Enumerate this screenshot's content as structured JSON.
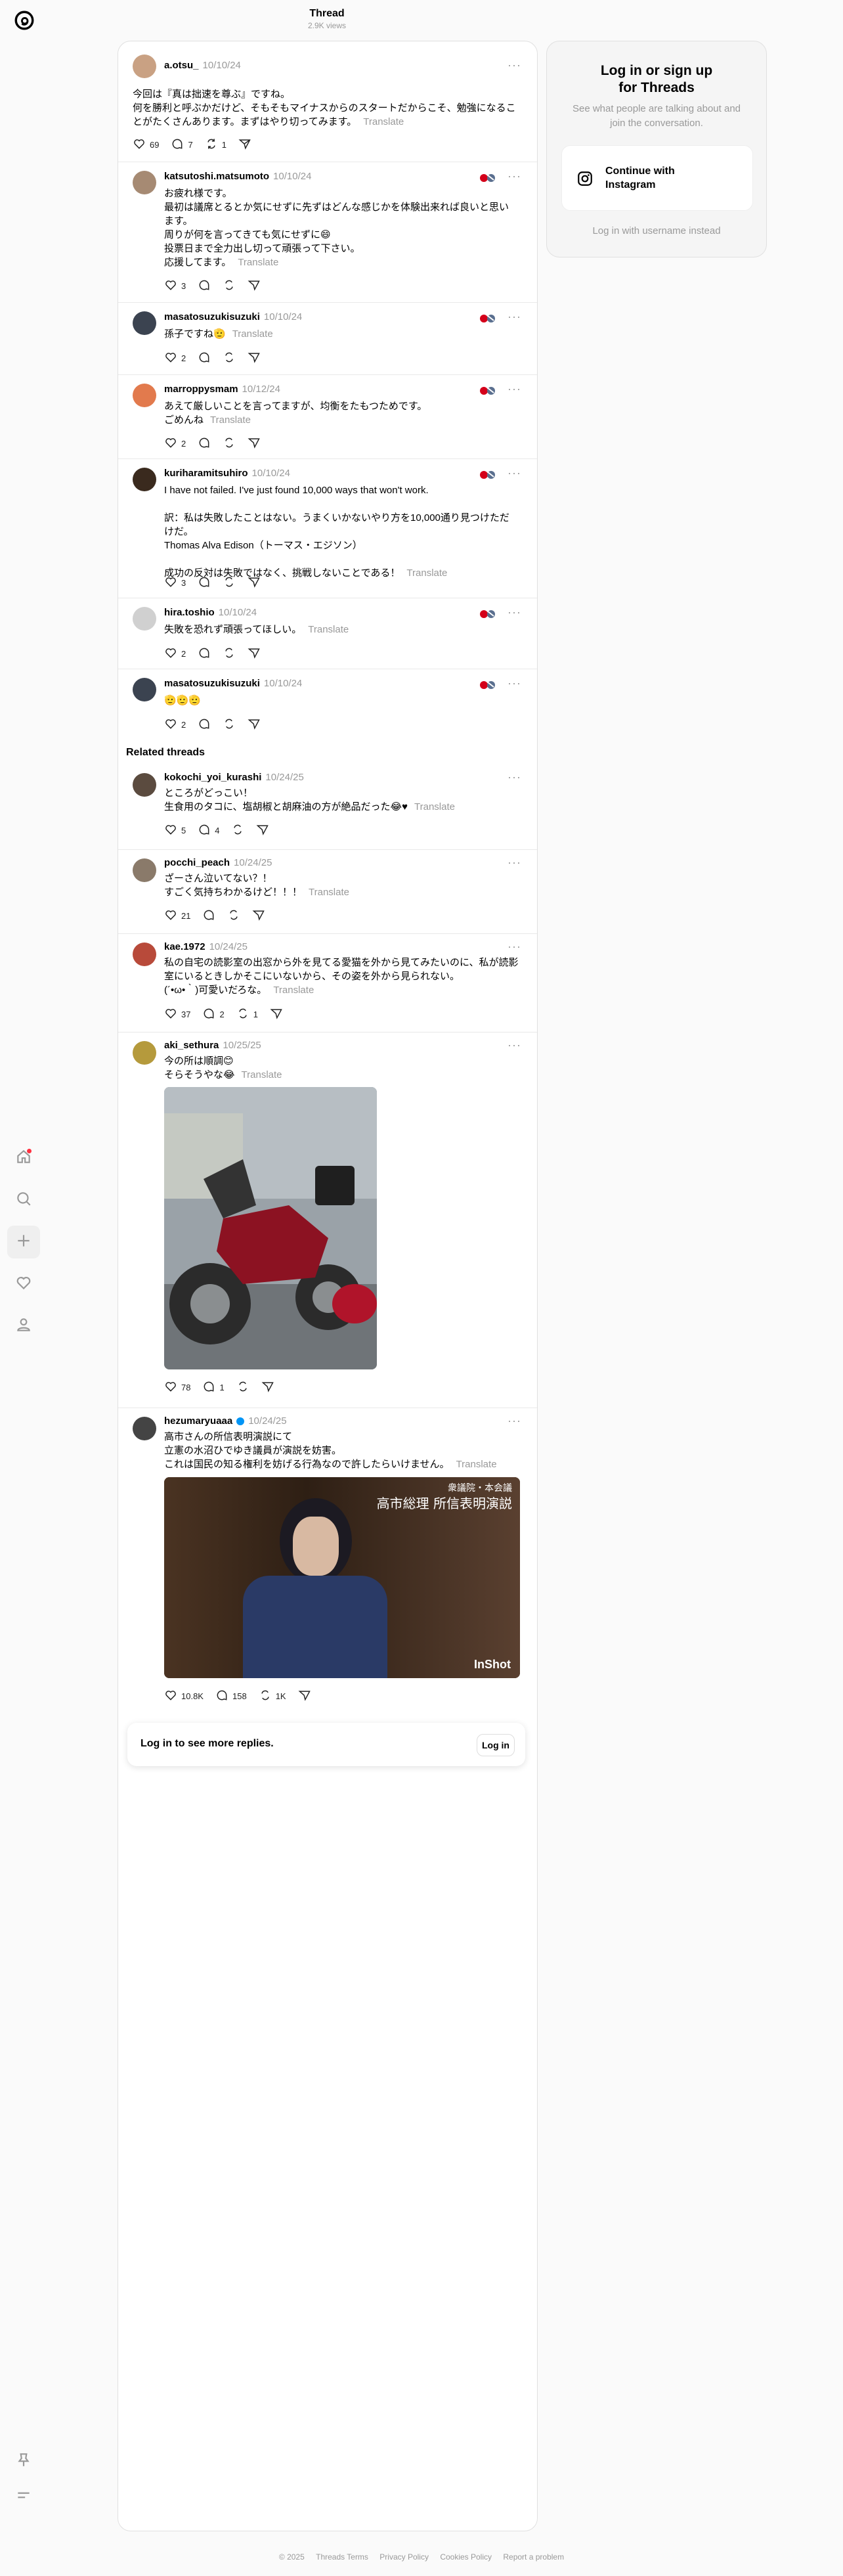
{
  "header": {
    "title": "Thread",
    "views": "2.9K views"
  },
  "nav": {
    "logo": "threads-logo-icon",
    "items": [
      "home-icon",
      "search-icon",
      "plus-icon",
      "heart-icon",
      "profile-icon"
    ],
    "bottom": [
      "pin-icon",
      "menu-icon"
    ]
  },
  "colors": {
    "accent": "#000000",
    "notification": "#ff3040",
    "muted": "#999999"
  },
  "main_post": {
    "user": "a.otsu_",
    "date": "10/10/24",
    "text": "今回は『真は拙速を尊ぶ』ですね。\n何を勝利と呼ぶかだけど、そもそもマイナスからのスタートだからこそ、勉強になるこ\nとがたくさんあります。まずはやり切ってみます。",
    "translate": "Translate",
    "likes": "69",
    "replies": "7",
    "reposts": "1"
  },
  "replies": [
    {
      "user": "katsutoshi.matsumoto",
      "date": "10/10/24",
      "text": "お疲れ様です。\n最初は議席とるとか気にせずに先ずはどんな感じかを体験出来れば良いと思い\nます。\n周りが何を言ってきても気にせずに😄\n投票日まで全力出し切って頑張って下さい。\n応援してます。",
      "translate": "Translate",
      "likes": "3"
    },
    {
      "user": "masatosuzukisuzuki",
      "date": "10/10/24",
      "text": "孫子ですね🫡",
      "translate": "Translate",
      "likes": "2"
    },
    {
      "user": "marroppysmam",
      "date": "10/12/24",
      "text": "あえて厳しいことを言ってますが、均衡をたもつためです。\nごめんね",
      "translate": "Translate",
      "likes": "2"
    },
    {
      "user": "kuriharamitsuhiro",
      "date": "10/10/24",
      "text": "I have not failed. I've just found 10,000 ways that won't work.\n\n訳：私は失敗したことはない。うまくいかないやり方を10,000通り見つけただ\nけだ。\nThomas Alva Edison（トーマス・エジソン）\n\n成功の反対は失敗ではなく、挑戦しないことである！",
      "translate": "Translate",
      "likes": "3"
    },
    {
      "user": "hira.toshio",
      "date": "10/10/24",
      "text": "失敗を恐れず頑張ってほしい。",
      "translate": "Translate",
      "likes": "2"
    },
    {
      "user": "masatosuzukisuzuki",
      "date": "10/10/24",
      "text": "🫡🫡🫡",
      "translate": "",
      "likes": "2"
    }
  ],
  "related_title": "Related threads",
  "related": [
    {
      "user": "kokochi_yoi_kurashi",
      "date": "10/24/25",
      "text": "ところがどっこい！\n生食用のタコに、塩胡椒と胡麻油の方が絶品だった😂♥",
      "translate": "Translate",
      "likes": "5",
      "replies": "4",
      "reposts": ""
    },
    {
      "user": "pocchi_peach",
      "date": "10/24/25",
      "text": "ざーさん泣いてない？！\nすごく気持ちわかるけど！！！",
      "translate": "Translate",
      "likes": "21",
      "replies": "",
      "reposts": ""
    },
    {
      "user": "kae.1972",
      "date": "10/24/25",
      "text": "私の自宅の読影室の出窓から外を見てる愛猫を外から見てみたいのに、私が読影\n室にいるときしかそこにいないから、その姿を外から見られない。\n(´•ω•｀)可愛いだろな。",
      "translate": "Translate",
      "likes": "37",
      "replies": "2",
      "reposts": "1"
    },
    {
      "user": "aki_sethura",
      "date": "10/25/25",
      "text": "今の所は順調😊\nそらそうやな😂",
      "translate": "Translate",
      "likes": "78",
      "replies": "1",
      "reposts": ""
    },
    {
      "user": "hezumaryuaaa",
      "date": "10/24/25",
      "text": "高市さんの所信表明演説にて\n立憲の水沼ひでゆき議員が演説を妨害。\nこれは国民の知る権利を妨げる行為なので許したらいけません。",
      "translate": "Translate",
      "likes": "10.8K",
      "replies": "158",
      "reposts": "1K",
      "video_caption": "衆議院・本会議",
      "video_title": "高市総理 所信表明演説",
      "video_watermark": "InShot"
    }
  ],
  "login_bar": {
    "message": "Log in to see more replies.",
    "button": "Log in"
  },
  "sidebar_card": {
    "title": "Log in or sign up\nfor Threads",
    "subtitle": "See what people are talking about and join the conversation.",
    "instagram_button": "Continue with\nInstagram",
    "username_link": "Log in with username instead"
  },
  "footer": [
    "© 2025",
    "Threads Terms",
    "Privacy Policy",
    "Cookies Policy",
    "Report a problem"
  ]
}
